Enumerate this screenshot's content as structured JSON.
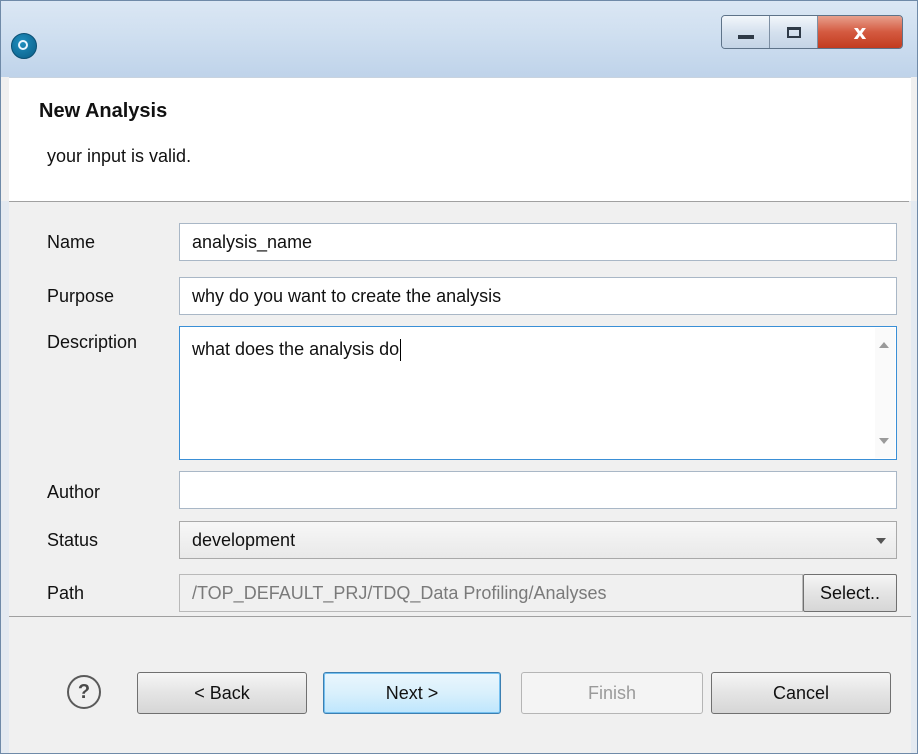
{
  "window": {
    "icon": "talend-app-icon",
    "controls": {
      "minimize": "minimize-icon",
      "maximize": "maximize-icon",
      "close": "x"
    }
  },
  "header": {
    "title": "New Analysis",
    "message": "your input is valid."
  },
  "form": {
    "name": {
      "label": "Name",
      "value": "analysis_name"
    },
    "purpose": {
      "label": "Purpose",
      "value": "why do you want to create the analysis"
    },
    "description": {
      "label": "Description",
      "value": "what does the analysis do"
    },
    "author": {
      "label": "Author",
      "value": ""
    },
    "status": {
      "label": "Status",
      "value": "development"
    },
    "path": {
      "label": "Path",
      "value": "/TOP_DEFAULT_PRJ/TDQ_Data Profiling/Analyses",
      "select_label": "Select.."
    }
  },
  "footer": {
    "help": "?",
    "back": "< Back",
    "next": "Next >",
    "finish": "Finish",
    "cancel": "Cancel"
  },
  "colors": {
    "accent": "#3c7fb1",
    "close": "#c23b1f"
  }
}
